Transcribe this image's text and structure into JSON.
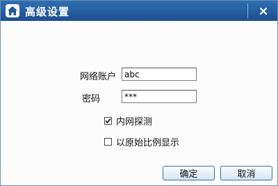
{
  "window": {
    "title": "高级设置",
    "title_icon": "home-icon",
    "close_icon": "close-icon",
    "title_bar_color": "#1f5a9b"
  },
  "form": {
    "account_label": "网络账户",
    "account_value": "abc",
    "password_label": "密码",
    "password_value": "***"
  },
  "options": {
    "probe_label": "内网探测",
    "probe_checked": true,
    "ratio_label": "以原始比例显示",
    "ratio_checked": false
  },
  "buttons": {
    "ok_label": "确定",
    "cancel_label": "取消"
  }
}
